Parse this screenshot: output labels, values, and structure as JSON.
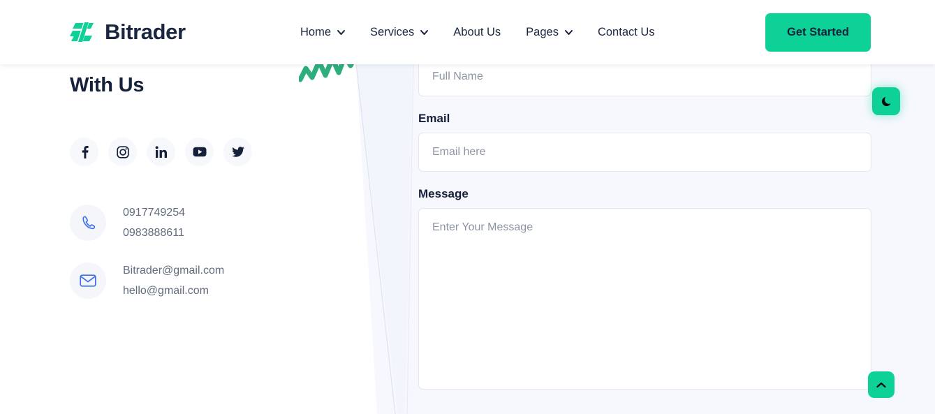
{
  "header": {
    "brand": "Bitrader",
    "brand_icon": "bitrader-logo-icon",
    "nav": [
      {
        "label": "Home",
        "has_dropdown": true
      },
      {
        "label": "Services",
        "has_dropdown": true
      },
      {
        "label": "About Us",
        "has_dropdown": false
      },
      {
        "label": "Pages",
        "has_dropdown": true
      },
      {
        "label": "Contact Us",
        "has_dropdown": false
      }
    ],
    "cta_label": "Get Started"
  },
  "left": {
    "title": "With Us",
    "socials": [
      {
        "name": "facebook"
      },
      {
        "name": "instagram"
      },
      {
        "name": "linkedin"
      },
      {
        "name": "youtube"
      },
      {
        "name": "twitter"
      }
    ],
    "contacts": [
      {
        "icon": "phone-icon",
        "lines": [
          "0917749254",
          "0983888611"
        ]
      },
      {
        "icon": "email-icon",
        "lines": [
          "Bitrader@gmail.com",
          "hello@gmail.com"
        ]
      }
    ]
  },
  "form": {
    "name": {
      "value": "",
      "placeholder": "Full Name"
    },
    "email": {
      "label": "Email",
      "value": "",
      "placeholder": "Email here"
    },
    "message": {
      "label": "Message",
      "value": "",
      "placeholder": "Enter Your Message"
    }
  },
  "floating": {
    "dark_mode_icon": "moon-icon",
    "scroll_top_icon": "chevron-up-icon"
  },
  "colors": {
    "accent": "#0ed198",
    "dark": "#16203a",
    "muted": "#636b7e",
    "panel": "#f7f8fd"
  }
}
